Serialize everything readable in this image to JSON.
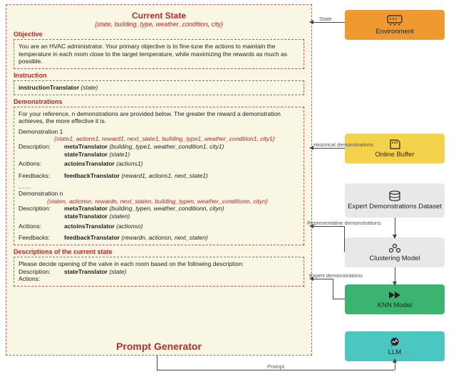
{
  "panel": {
    "title": "Current State",
    "subtitle": "{state, building_type, weather_condition, city}",
    "objective_hdr": "Objective",
    "objective_body": "You are an HVAC administrator. Your primary objective is to fine-tune the actions to maintain the temperature in each room close to the target temperature, while maximizing the rewards as much as possible.",
    "instruction_hdr": "Instruction",
    "instruction_fn": "instructionTranslator",
    "instruction_arg": "(state)",
    "demos_hdr": "Demonstrations",
    "demos_intro": "For your reference, n demonstrations are provided below. The greater the reward a demonstration achieves, the more effective it is.",
    "demo1_label": "Demonstration 1",
    "demo1_tuple": "{state1, actions1, reward1, next_state1, building_type1, weather_condition1, city1}",
    "desc_lbl": "Description:",
    "meta_fn": "metaTranslator",
    "meta1_arg": "(building_type1, weather_condition1, city1)",
    "state_fn": "stateTranslator",
    "state1_arg": "(state1)",
    "actions_lbl": "Acitions:",
    "actions_fn": "actoinsTranslator",
    "actions1_arg": "(actions1)",
    "feedbacks_lbl": "Feedbacks:",
    "feedback_fn": "feedbackTranslator",
    "feedback1_arg": "(reward1, actions1, next_state1)",
    "ellipsis": "……",
    "demon_label": "Demonstration n",
    "demon_tuple": "{staten, actionsn, rewardn, next_staten, building_typen, weather_conditionn, cityn}",
    "metan_arg": "(building_typen, weather_conditionn, cityn)",
    "staten_arg": "(staten)",
    "actionsn_arg": "(actionsn)",
    "feedbackn_arg": "(rewardn, actionsn, next_staten)",
    "descstate_hdr": "Descriptions of the current state",
    "descstate_body": "Please decide opening of the valve in each room based on the following description:",
    "descstate_desc_lbl": "Description:",
    "descstate_fn": "stateTranslator",
    "descstate_arg": "(state)",
    "descstate_actions_lbl": "Actions:",
    "footer": "Prompt Generator"
  },
  "modules": {
    "env": "Environment",
    "buffer": "Online Buffer",
    "dataset": "Expert Demonstrations Dataset",
    "cluster": "Clustering Model",
    "knn": "KNN Model",
    "llm": "LLM"
  },
  "arrows": {
    "state": "State",
    "hist": "Historical demonstrations",
    "repr": "Representative demonstrations",
    "expert": "Expert demonstrations",
    "prompt": "Prompt"
  }
}
